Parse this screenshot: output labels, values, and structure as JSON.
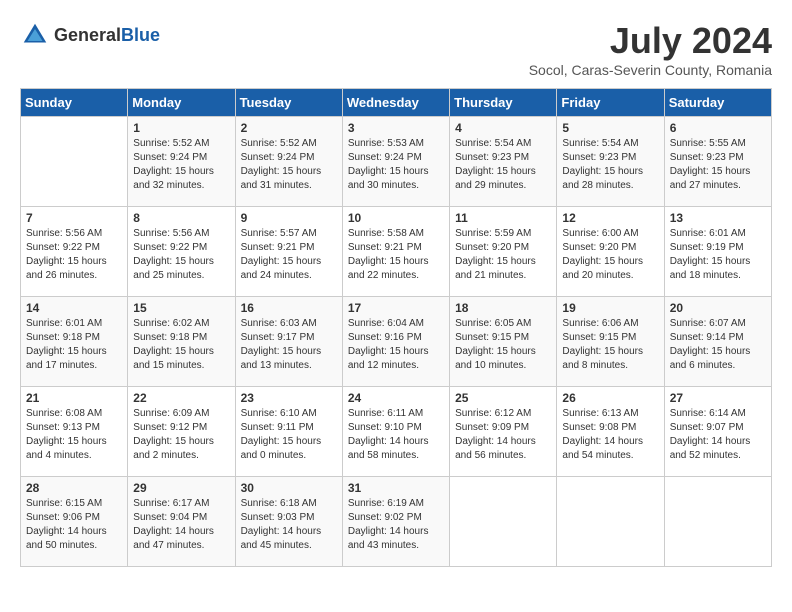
{
  "logo": {
    "general": "General",
    "blue": "Blue"
  },
  "title": "July 2024",
  "location": "Socol, Caras-Severin County, Romania",
  "days_of_week": [
    "Sunday",
    "Monday",
    "Tuesday",
    "Wednesday",
    "Thursday",
    "Friday",
    "Saturday"
  ],
  "weeks": [
    [
      {
        "day": "",
        "sunrise": "",
        "sunset": "",
        "daylight": ""
      },
      {
        "day": "1",
        "sunrise": "Sunrise: 5:52 AM",
        "sunset": "Sunset: 9:24 PM",
        "daylight": "Daylight: 15 hours and 32 minutes."
      },
      {
        "day": "2",
        "sunrise": "Sunrise: 5:52 AM",
        "sunset": "Sunset: 9:24 PM",
        "daylight": "Daylight: 15 hours and 31 minutes."
      },
      {
        "day": "3",
        "sunrise": "Sunrise: 5:53 AM",
        "sunset": "Sunset: 9:24 PM",
        "daylight": "Daylight: 15 hours and 30 minutes."
      },
      {
        "day": "4",
        "sunrise": "Sunrise: 5:54 AM",
        "sunset": "Sunset: 9:23 PM",
        "daylight": "Daylight: 15 hours and 29 minutes."
      },
      {
        "day": "5",
        "sunrise": "Sunrise: 5:54 AM",
        "sunset": "Sunset: 9:23 PM",
        "daylight": "Daylight: 15 hours and 28 minutes."
      },
      {
        "day": "6",
        "sunrise": "Sunrise: 5:55 AM",
        "sunset": "Sunset: 9:23 PM",
        "daylight": "Daylight: 15 hours and 27 minutes."
      }
    ],
    [
      {
        "day": "7",
        "sunrise": "Sunrise: 5:56 AM",
        "sunset": "Sunset: 9:22 PM",
        "daylight": "Daylight: 15 hours and 26 minutes."
      },
      {
        "day": "8",
        "sunrise": "Sunrise: 5:56 AM",
        "sunset": "Sunset: 9:22 PM",
        "daylight": "Daylight: 15 hours and 25 minutes."
      },
      {
        "day": "9",
        "sunrise": "Sunrise: 5:57 AM",
        "sunset": "Sunset: 9:21 PM",
        "daylight": "Daylight: 15 hours and 24 minutes."
      },
      {
        "day": "10",
        "sunrise": "Sunrise: 5:58 AM",
        "sunset": "Sunset: 9:21 PM",
        "daylight": "Daylight: 15 hours and 22 minutes."
      },
      {
        "day": "11",
        "sunrise": "Sunrise: 5:59 AM",
        "sunset": "Sunset: 9:20 PM",
        "daylight": "Daylight: 15 hours and 21 minutes."
      },
      {
        "day": "12",
        "sunrise": "Sunrise: 6:00 AM",
        "sunset": "Sunset: 9:20 PM",
        "daylight": "Daylight: 15 hours and 20 minutes."
      },
      {
        "day": "13",
        "sunrise": "Sunrise: 6:01 AM",
        "sunset": "Sunset: 9:19 PM",
        "daylight": "Daylight: 15 hours and 18 minutes."
      }
    ],
    [
      {
        "day": "14",
        "sunrise": "Sunrise: 6:01 AM",
        "sunset": "Sunset: 9:18 PM",
        "daylight": "Daylight: 15 hours and 17 minutes."
      },
      {
        "day": "15",
        "sunrise": "Sunrise: 6:02 AM",
        "sunset": "Sunset: 9:18 PM",
        "daylight": "Daylight: 15 hours and 15 minutes."
      },
      {
        "day": "16",
        "sunrise": "Sunrise: 6:03 AM",
        "sunset": "Sunset: 9:17 PM",
        "daylight": "Daylight: 15 hours and 13 minutes."
      },
      {
        "day": "17",
        "sunrise": "Sunrise: 6:04 AM",
        "sunset": "Sunset: 9:16 PM",
        "daylight": "Daylight: 15 hours and 12 minutes."
      },
      {
        "day": "18",
        "sunrise": "Sunrise: 6:05 AM",
        "sunset": "Sunset: 9:15 PM",
        "daylight": "Daylight: 15 hours and 10 minutes."
      },
      {
        "day": "19",
        "sunrise": "Sunrise: 6:06 AM",
        "sunset": "Sunset: 9:15 PM",
        "daylight": "Daylight: 15 hours and 8 minutes."
      },
      {
        "day": "20",
        "sunrise": "Sunrise: 6:07 AM",
        "sunset": "Sunset: 9:14 PM",
        "daylight": "Daylight: 15 hours and 6 minutes."
      }
    ],
    [
      {
        "day": "21",
        "sunrise": "Sunrise: 6:08 AM",
        "sunset": "Sunset: 9:13 PM",
        "daylight": "Daylight: 15 hours and 4 minutes."
      },
      {
        "day": "22",
        "sunrise": "Sunrise: 6:09 AM",
        "sunset": "Sunset: 9:12 PM",
        "daylight": "Daylight: 15 hours and 2 minutes."
      },
      {
        "day": "23",
        "sunrise": "Sunrise: 6:10 AM",
        "sunset": "Sunset: 9:11 PM",
        "daylight": "Daylight: 15 hours and 0 minutes."
      },
      {
        "day": "24",
        "sunrise": "Sunrise: 6:11 AM",
        "sunset": "Sunset: 9:10 PM",
        "daylight": "Daylight: 14 hours and 58 minutes."
      },
      {
        "day": "25",
        "sunrise": "Sunrise: 6:12 AM",
        "sunset": "Sunset: 9:09 PM",
        "daylight": "Daylight: 14 hours and 56 minutes."
      },
      {
        "day": "26",
        "sunrise": "Sunrise: 6:13 AM",
        "sunset": "Sunset: 9:08 PM",
        "daylight": "Daylight: 14 hours and 54 minutes."
      },
      {
        "day": "27",
        "sunrise": "Sunrise: 6:14 AM",
        "sunset": "Sunset: 9:07 PM",
        "daylight": "Daylight: 14 hours and 52 minutes."
      }
    ],
    [
      {
        "day": "28",
        "sunrise": "Sunrise: 6:15 AM",
        "sunset": "Sunset: 9:06 PM",
        "daylight": "Daylight: 14 hours and 50 minutes."
      },
      {
        "day": "29",
        "sunrise": "Sunrise: 6:17 AM",
        "sunset": "Sunset: 9:04 PM",
        "daylight": "Daylight: 14 hours and 47 minutes."
      },
      {
        "day": "30",
        "sunrise": "Sunrise: 6:18 AM",
        "sunset": "Sunset: 9:03 PM",
        "daylight": "Daylight: 14 hours and 45 minutes."
      },
      {
        "day": "31",
        "sunrise": "Sunrise: 6:19 AM",
        "sunset": "Sunset: 9:02 PM",
        "daylight": "Daylight: 14 hours and 43 minutes."
      },
      {
        "day": "",
        "sunrise": "",
        "sunset": "",
        "daylight": ""
      },
      {
        "day": "",
        "sunrise": "",
        "sunset": "",
        "daylight": ""
      },
      {
        "day": "",
        "sunrise": "",
        "sunset": "",
        "daylight": ""
      }
    ]
  ]
}
